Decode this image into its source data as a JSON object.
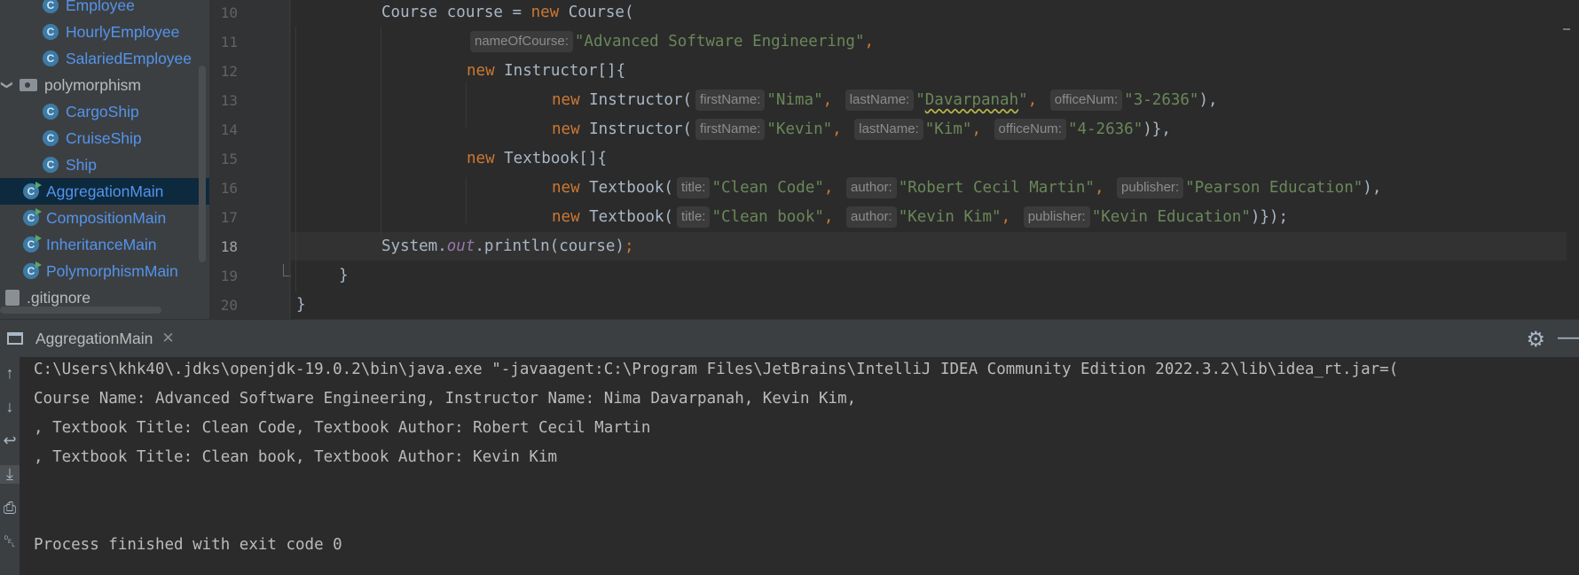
{
  "tree": {
    "items": [
      {
        "label": "Employee",
        "type": "class"
      },
      {
        "label": "HourlyEmployee",
        "type": "class"
      },
      {
        "label": "SalariedEmployee",
        "type": "class"
      },
      {
        "label": "polymorphism",
        "type": "package"
      },
      {
        "label": "CargoShip",
        "type": "class"
      },
      {
        "label": "CruiseShip",
        "type": "class"
      },
      {
        "label": "Ship",
        "type": "class"
      },
      {
        "label": "AggregationMain",
        "type": "main",
        "selected": true
      },
      {
        "label": "CompositionMain",
        "type": "main"
      },
      {
        "label": "InheritanceMain",
        "type": "main"
      },
      {
        "label": "PolymorphismMain",
        "type": "main"
      },
      {
        "label": ".gitignore",
        "type": "file"
      }
    ]
  },
  "editor": {
    "line_numbers": [
      "10",
      "11",
      "12",
      "13",
      "14",
      "15",
      "16",
      "17",
      "18",
      "19",
      "20"
    ],
    "current_line": "18",
    "hints": {
      "nameOfCourse": "nameOfCourse:",
      "firstName": "firstName:",
      "lastName": "lastName:",
      "officeNum": "officeNum:",
      "title": "title:",
      "author": "author:",
      "publisher": "publisher:"
    },
    "tokens": {
      "l10_a": "Course course = ",
      "kw_new": "new",
      "l10_b": " Course(",
      "s_course": "\"Advanced Software Engineering\"",
      "comma": ",",
      "comma_sp": ", ",
      "l12_b": " Instructor[]{",
      "instr_open": " Instructor(",
      "s_nima": "\"Nima\"",
      "s_davar_q1": "\"",
      "s_davar": "Davarpanah",
      "s_davar_q2": "\"",
      "s_off1": "\"3-2636\"",
      "close_comma": "),",
      "s_kevin": "\"Kevin\"",
      "s_kim": "\"Kim\"",
      "s_off2": "\"4-2636\"",
      "close_arr": ")},",
      "l15_b": " Textbook[]{",
      "tb_open": " Textbook(",
      "s_cc": "\"Clean Code\"",
      "s_rcm": "\"Robert Cecil Martin\"",
      "s_pe": "\"Pearson Education\"",
      "s_cb": "\"Clean book\"",
      "s_kk": "\"Kevin Kim\"",
      "s_ke": "\"Kevin Education\"",
      "close_all": ")});",
      "l18_a": "System.",
      "l18_out": "out",
      "l18_b": ".println(course)",
      "semi": ";",
      "l19": "}",
      "l20": "}"
    }
  },
  "run": {
    "tab_label": "AggregationMain",
    "output": [
      "C:\\Users\\khk40\\.jdks\\openjdk-19.0.2\\bin\\java.exe \"-javaagent:C:\\Program Files\\JetBrains\\IntelliJ IDEA Community Edition 2022.3.2\\lib\\idea_rt.jar=(",
      "Course Name: Advanced Software Engineering, Instructor Name: Nima Davarpanah, Kevin Kim,",
      ", Textbook Title: Clean Code, Textbook Author: Robert Cecil Martin",
      ", Textbook Title: Clean book, Textbook Author: Kevin Kim",
      "",
      "",
      "Process finished with exit code 0"
    ]
  },
  "colors": {
    "keyword": "#cc7832",
    "string": "#6a8759",
    "text": "#a9b7c6",
    "class_icon": "#3d7ba6"
  }
}
